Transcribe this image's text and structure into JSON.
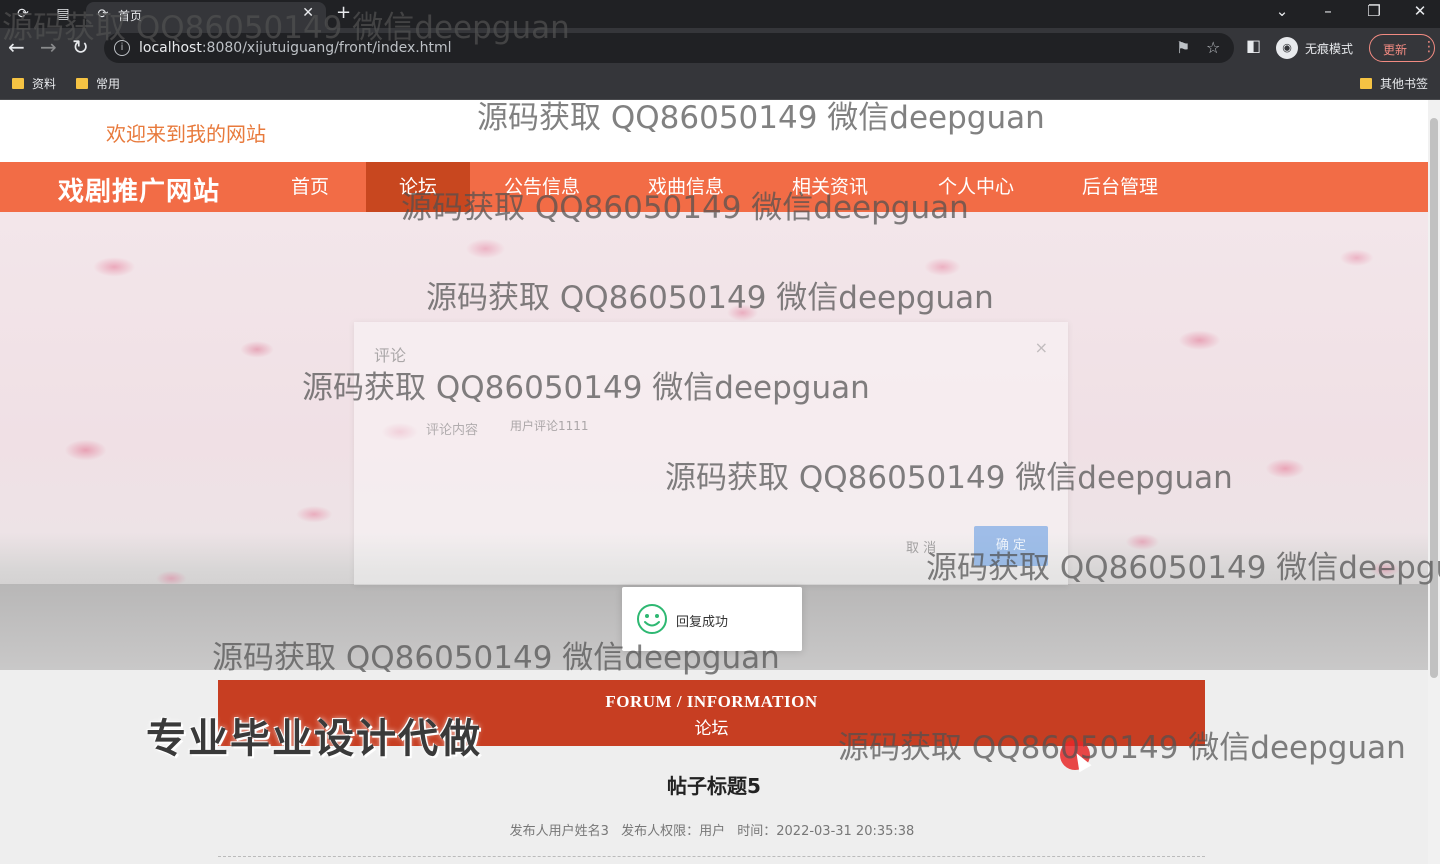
{
  "browser": {
    "tab_title": "首页",
    "url_host": "localhost",
    "url_rest": ":8080/xijutuiguang/front/index.html",
    "incognito_label": "无痕模式",
    "update_label": "更新",
    "bookmarks": [
      "资料",
      "常用"
    ],
    "other_bookmarks": "其他书签"
  },
  "site": {
    "welcome": "欢迎来到我的网站",
    "name": "戏剧推广网站",
    "nav": [
      "首页",
      "论坛",
      "公告信息",
      "戏曲信息",
      "相关资讯",
      "个人中心",
      "后台管理"
    ],
    "active_nav": "论坛"
  },
  "dialog": {
    "title": "评论",
    "close": "×",
    "field_label": "评论内容",
    "field_value": "用户评论1111",
    "cancel": "取 消",
    "confirm": "确 定"
  },
  "toast": {
    "message": "回复成功"
  },
  "section": {
    "title_en": "FORUM / INFORMATION",
    "title_cn": "论坛"
  },
  "post": {
    "title": "帖子标题5",
    "author": "发布人用户姓名3",
    "role": "发布人权限：用户",
    "time": "时间：2022-03-31 20:35:38"
  },
  "overlay": {
    "watermark": "源码获取 QQ86050149 微信deepguan",
    "promo": "专业毕业设计代做"
  },
  "icons": {
    "back": "back-arrow-icon",
    "forward": "forward-arrow-icon",
    "reload": "reload-icon",
    "star": "star-icon",
    "incognito": "incognito-icon",
    "success": "smile-icon"
  },
  "colors": {
    "nav_bar": "#f26c46",
    "nav_active": "#c8471f",
    "section_banner": "#c73e22",
    "welcome_text": "#e87a3c"
  }
}
